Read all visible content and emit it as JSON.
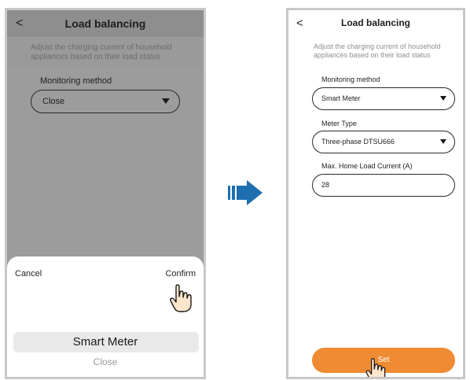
{
  "left_screen": {
    "back_icon": "chevron-left-icon",
    "title": "Load balancing",
    "hint": "Adjust the charging current of household appliances based on their load status",
    "monitoring_label": "Monitoring method",
    "monitoring_value": "Close",
    "sheet": {
      "cancel_label": "Cancel",
      "confirm_label": "Confirm",
      "options": [
        "Smart Meter",
        "Close"
      ],
      "selected": "Smart Meter",
      "other": "Close"
    }
  },
  "arrow_icon": "arrow-right-icon",
  "right_screen": {
    "back_icon": "chevron-left-icon",
    "title": "Load balancing",
    "hint": "Adjust the charging current of household appliances based on their load status",
    "monitoring_label": "Monitoring method",
    "monitoring_value": "Smart Meter",
    "meter_type_label": "Meter Type",
    "meter_type_value": "Three-phase DTSU666",
    "max_current_label": "Max. Home Load Current (A)",
    "max_current_value": "28",
    "set_label": "Set"
  },
  "colors": {
    "accent": "#ef8b32",
    "arrow": "#1d6fb0",
    "overlay": "#9c9c9c"
  }
}
